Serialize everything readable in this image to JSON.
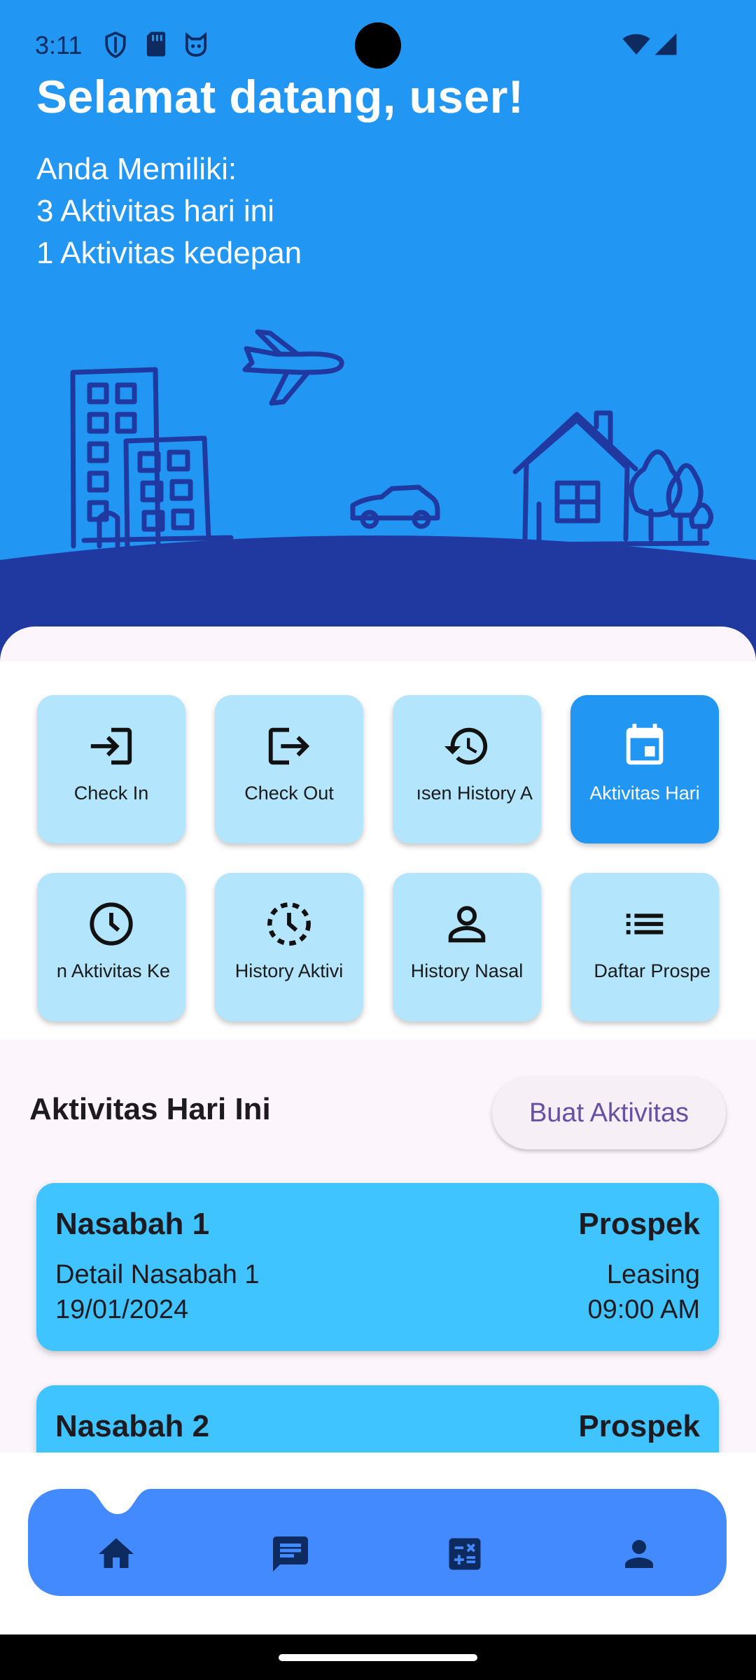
{
  "status_bar": {
    "time": "3:11",
    "left_icons": [
      "shield-icon",
      "sim-card-icon",
      "cat-face-icon"
    ],
    "right_icons": [
      "wifi-icon",
      "cell-signal-icon"
    ]
  },
  "header": {
    "welcome": "Selamat datang, user!",
    "summary_lines": [
      "Anda Memiliki:",
      "3 Aktivitas hari ini",
      "1 Aktivitas kedepan"
    ]
  },
  "menu": {
    "tiles": [
      {
        "label": "Check In",
        "icon": "login-icon",
        "active": false
      },
      {
        "label": "Check Out",
        "icon": "logout-icon",
        "active": false
      },
      {
        "label": "ısen History A",
        "icon": "history-icon",
        "active": false
      },
      {
        "label": "Aktivitas Hari",
        "icon": "calendar-icon",
        "active": true
      },
      {
        "label": "n Aktivitas Ke",
        "icon": "clock-icon",
        "active": false
      },
      {
        "label": "History Aktivi",
        "icon": "dashed-clock-icon",
        "active": false
      },
      {
        "label": "History Nasal",
        "icon": "person-icon",
        "active": false
      },
      {
        "label": "Daftar Prospe",
        "icon": "list-icon",
        "active": false
      }
    ]
  },
  "activities": {
    "title": "Aktivitas Hari Ini",
    "create_button": "Buat Aktivitas",
    "cards": [
      {
        "name": "Nasabah 1",
        "type": "Prospek",
        "detail": "Detail Nasabah 1",
        "category": "Leasing",
        "date": "19/01/2024",
        "time": "09:00 AM"
      },
      {
        "name": "Nasabah 2",
        "type": "Prospek"
      }
    ]
  },
  "bottom_nav": {
    "items": [
      "home-icon",
      "chat-icon",
      "calculator-icon",
      "account-icon"
    ]
  },
  "colors": {
    "hero": "#2196f3",
    "ground": "#2039a0",
    "tile": "#b3e5fc",
    "tile_active": "#2196f3",
    "card": "#40c4ff",
    "nav_bar": "#448aff",
    "nav_icon": "#0d2b5e"
  }
}
